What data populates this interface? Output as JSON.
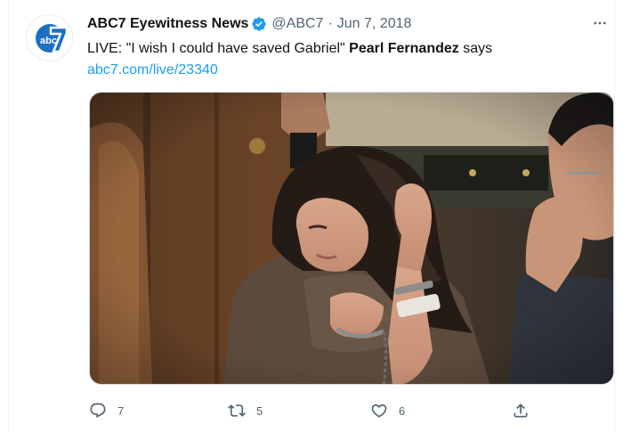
{
  "tweet": {
    "author": {
      "display_name": "ABC7 Eyewitness News",
      "handle": "@ABC7",
      "verified": true,
      "avatar_logo": "abc7"
    },
    "separator": "·",
    "date": "Jun 7, 2018",
    "text_prefix": "LIVE: \"I wish I could have saved Gabriel\" ",
    "text_bold": "Pearl Fernandez",
    "text_suffix": " says",
    "link": "abc7.com/live/23340",
    "media_alt": "Courtroom photo of a woman in a brown jumpsuit holding her head",
    "actions": {
      "reply_count": "7",
      "retweet_count": "5",
      "like_count": "6"
    },
    "icons": {
      "verified": "verified-badge-icon",
      "more": "more-icon",
      "reply": "reply-icon",
      "retweet": "retweet-icon",
      "like": "heart-icon",
      "share": "share-icon"
    },
    "colors": {
      "link": "#1d9bf0",
      "muted": "#536471",
      "verified": "#1d9bf0",
      "text": "#0f1419"
    }
  }
}
